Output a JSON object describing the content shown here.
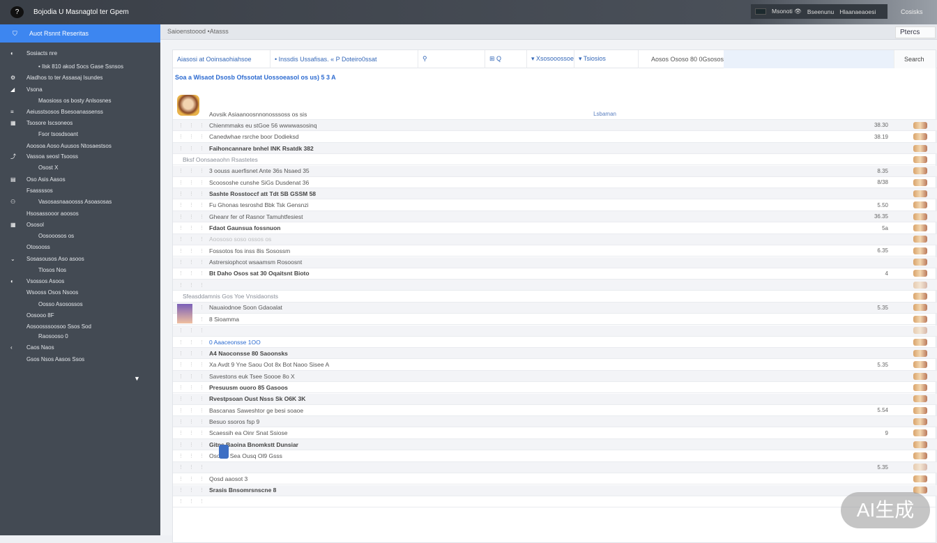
{
  "app": {
    "title": "Bojodia U Masnagtol ter Gpem",
    "logo_icon": "info-icon"
  },
  "topnav": {
    "items": [
      "Msonoti 👁",
      "Bseenunu",
      "Hlaanaeaoesi"
    ],
    "right": "Cosisks"
  },
  "sidebar": {
    "active": "Auot Rsnnt Reseritas",
    "items": [
      {
        "icon": "user-icon",
        "label": "Sosiacts nre"
      },
      {
        "icon": "",
        "label": "• Ilsk 810 akod Socs Gase Ssnsos"
      },
      {
        "icon": "settings-icon",
        "label": "Aladhos to ter Assasaj Isundes"
      },
      {
        "icon": "chart-icon",
        "label": "Vsona"
      },
      {
        "icon": "",
        "label": "Maosioss os bosty Anlsosnes"
      },
      {
        "icon": "list-icon",
        "label": "Aeiusstsosos Bsesoanassenss"
      },
      {
        "icon": "grid-icon",
        "label": "Tsosore Iscsoneos"
      },
      {
        "icon": "",
        "label": "Fsor tsosdsoant"
      },
      {
        "icon": "",
        "label": "Aoosoa Aoso Auusos Ntosaestsos"
      },
      {
        "icon": "share-icon",
        "label": "Vassoa seosl Tsooss"
      },
      {
        "icon": "",
        "label": "Osost X"
      },
      {
        "icon": "doc-icon",
        "label": "Oso Asis Aasos"
      },
      {
        "icon": "",
        "label": "Fsassssos"
      },
      {
        "icon": "people-icon",
        "label": "Vasosasnaaoosss Asoasosas"
      },
      {
        "icon": "",
        "label": "Hsosassooor aoosos"
      },
      {
        "icon": "grid-icon",
        "label": "Ososol"
      },
      {
        "icon": "",
        "label": "Oosooosos os"
      },
      {
        "icon": "",
        "label": "Otosooss"
      },
      {
        "icon": "collapse-icon",
        "label": "Sosasousos Aso asoos"
      },
      {
        "icon": "",
        "label": "Tlosos Nos"
      },
      {
        "icon": "user-icon",
        "label": "Vsossos  Asoos"
      },
      {
        "icon": "",
        "label": "Wsooss Osos Nsoos"
      },
      {
        "icon": "",
        "label": "Oosso Asosossos"
      },
      {
        "icon": "",
        "label": "Oosooo 8F"
      },
      {
        "icon": "",
        "label": "Aosoosssoosoo Ssos Sod"
      },
      {
        "icon": "",
        "label": "Raosooso 0"
      },
      {
        "icon": "back-icon",
        "label": "Caos Naos"
      },
      {
        "icon": "",
        "label": "Gsos Nsos Aasos Ssos"
      }
    ]
  },
  "main": {
    "breadcrumb": "Saioenstoood  •Atasss",
    "top_button": "Ptercs",
    "toolbar": [
      "Aiasosi at Ooinsaohiahsoe",
      "• Inssdis Ussafisas. «   P Doteiro0ssat",
      "⚲",
      "⊞ Q",
      "▾ Xsosooossoe",
      "▾ Tsiosios",
      "Aosos Ososo  80  0Gsososs"
    ],
    "search": "Search",
    "heading": "Soa a Wisaot Dsosb Ofssotat Uossoeasol os us) 5 3 A",
    "rows": [
      {
        "text": "Aovsik Asiaanoosnnonosssoss os sis",
        "value": "Lsbaman",
        "kind": "header"
      },
      {
        "text": "Chienmmaks eu stGoe 56 wwwwasosinq",
        "value": "38.30"
      },
      {
        "text": "Canedwhae rsrche boor  Dodieksd",
        "value": "38.19"
      },
      {
        "text": "Faihoncannare bnhel INK Rsatdk 382",
        "value": "",
        "kind": "bold"
      },
      {
        "text": "Bksf Oonsaeaohn Rsastetes",
        "value": "",
        "kind": "section"
      },
      {
        "text": "3 oouss auerfisnet Ante 36s Nsaed 35",
        "value": "8.35"
      },
      {
        "text": "Scoososhe cunshe SiGs Dusdenat 36",
        "value": "8/38"
      },
      {
        "text": "Sashte Rosstoccf att Tdt SB GSSM 58",
        "value": "",
        "kind": "bold"
      },
      {
        "text": "Fu Ghonas tesroshd Bbk Tsk Gensnzi",
        "value": "5.50"
      },
      {
        "text": "Gheanr fer of Rasnor Tamuhtfesiest",
        "value": "36.35"
      },
      {
        "text": "Fdaot Gaunsua fossnuon",
        "value": "5a",
        "kind": "bold"
      },
      {
        "text": "Aoososo soso ossos os",
        "value": "",
        "kind": "faded"
      },
      {
        "text": "Fossotos fos inss 8is Sosossm",
        "value": "6.35"
      },
      {
        "text": "Astrersiophcot wsaamsm Rosoosnt",
        "value": ""
      },
      {
        "text": "Bt Daho Osos sat 30 Oqaitsnt Bioto",
        "value": "4",
        "kind": "bold"
      },
      {
        "text": "",
        "value": ""
      },
      {
        "text": "Sfeasddamnis Gos Yoe Vnsidaonsts",
        "value": "",
        "kind": "section"
      },
      {
        "text": "Nauaiodnoe Soon Gdaoalat",
        "value": "5.35"
      },
      {
        "text": "8 Sioamma",
        "value": ""
      },
      {
        "text": "",
        "value": ""
      },
      {
        "text": "0 Aaaceonsse 1OO",
        "value": "",
        "kind": "blue"
      },
      {
        "text": "A4 Naoconsse 80 Saoonsks",
        "value": "",
        "kind": "bold"
      },
      {
        "text": "Xa Avdt 9 Yne Saou Oot 8x Bot Naoo Sisee A",
        "value": "5.35"
      },
      {
        "text": "Savestons euk Tsee Soooe 8o X",
        "value": ""
      },
      {
        "text": "Presuusm ouoro 85 Gasoos",
        "value": "",
        "kind": "bold"
      },
      {
        "text": "Rvestpsoan Oust Nsss Sk O6K 3K",
        "value": "",
        "kind": "bold"
      },
      {
        "text": "Bascanas Saweshtor ge besi soaoe",
        "value": "5.54"
      },
      {
        "text": "Besuo ssoros fsp 9",
        "value": ""
      },
      {
        "text": "Scaessih ea Oinr Snat Ssiose",
        "value": "9"
      },
      {
        "text": "Gitns Baoina Bnomkstt Dunsiar",
        "value": "",
        "kind": "bold"
      },
      {
        "text": "Osoaat Sea Ousq Ol9 Gsss",
        "value": ""
      },
      {
        "text": "",
        "value": "5.35"
      },
      {
        "text": "Qosd aaosot 3",
        "value": ""
      },
      {
        "text": "Srasis Bnsomrsnscne 8",
        "value": "",
        "kind": "bold"
      },
      {
        "text": "",
        "value": ""
      }
    ]
  },
  "watermark": "AI生成"
}
